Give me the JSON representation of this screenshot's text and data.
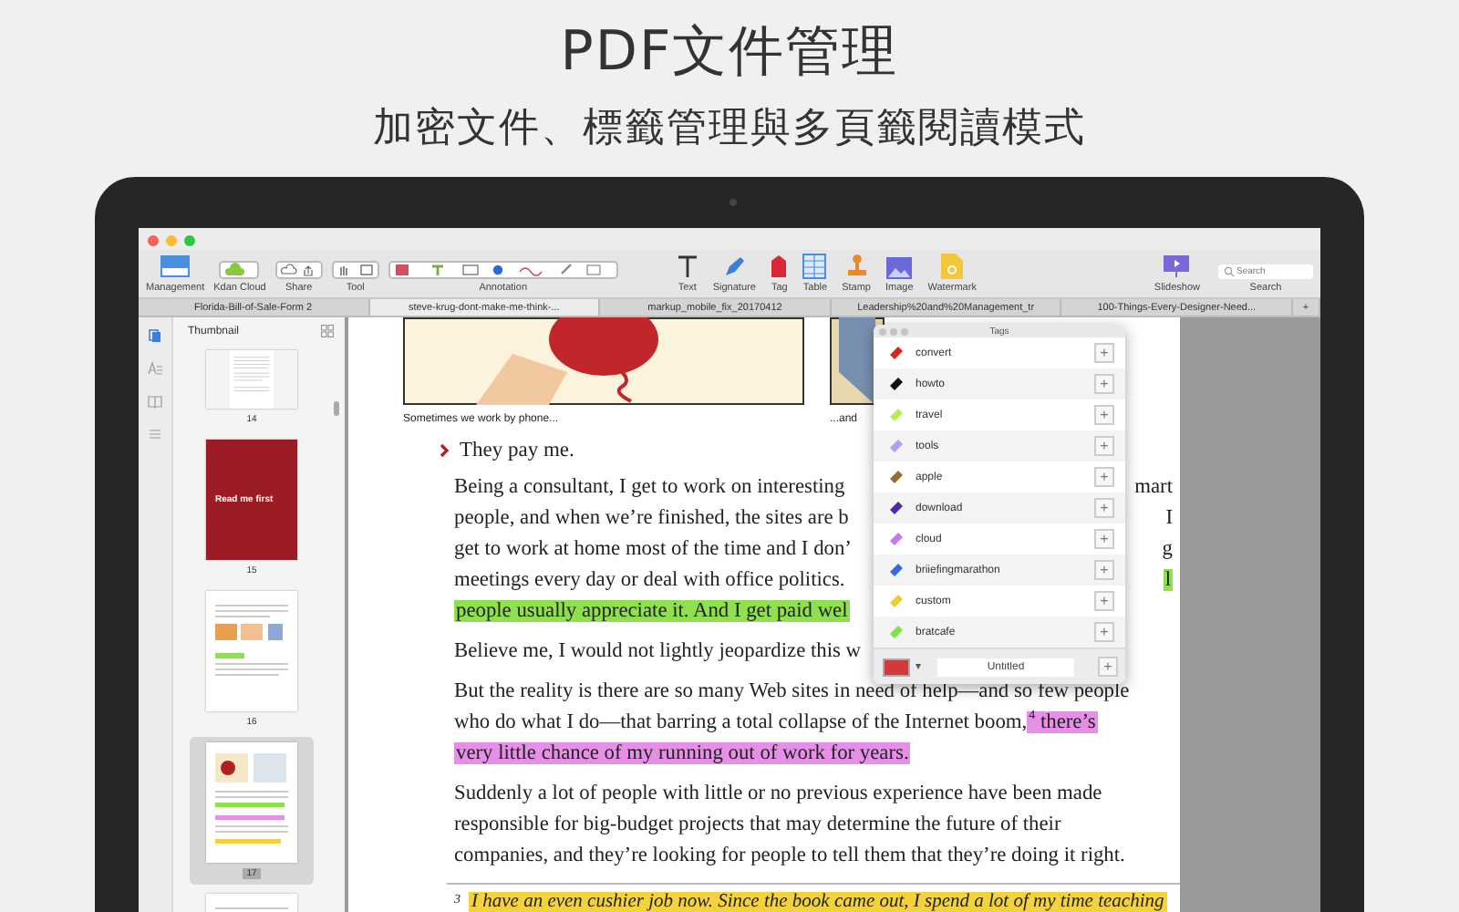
{
  "heading": {
    "title": "PDF文件管理",
    "subtitle": "加密文件、標籤管理與多頁籤閱讀模式"
  },
  "toolbar": [
    {
      "kind": "management",
      "label": "Management"
    },
    {
      "kind": "cloud",
      "label": "Kdan Cloud"
    },
    {
      "kind": "share",
      "label": "Share"
    },
    {
      "kind": "tool",
      "label": "Tool"
    },
    {
      "kind": "annotation",
      "label": "Annotation"
    },
    {
      "kind": "text",
      "label": "Text"
    },
    {
      "kind": "signature",
      "label": "Signature"
    },
    {
      "kind": "tag",
      "label": "Tag"
    },
    {
      "kind": "table",
      "label": "Table"
    },
    {
      "kind": "stamp",
      "label": "Stamp"
    },
    {
      "kind": "image",
      "label": "Image"
    },
    {
      "kind": "watermark",
      "label": "Watermark"
    },
    {
      "kind": "slideshow",
      "label": "Slideshow"
    },
    {
      "kind": "search",
      "label": "Search",
      "placeholder": "Search"
    }
  ],
  "tabs": [
    {
      "label": "Florida-Bill-of-Sale-Form 2",
      "selected": false
    },
    {
      "label": "steve-krug-dont-make-me-think-...",
      "selected": true
    },
    {
      "label": "markup_mobile_fix_20170412",
      "selected": false
    },
    {
      "label": "Leadership%20and%20Management_tr",
      "selected": false
    },
    {
      "label": "100-Things-Every-Designer-Need...",
      "selected": false
    },
    {
      "label": "+",
      "selected": false
    }
  ],
  "sidebar": {
    "icons": [
      {
        "kind": "pages",
        "selected": true
      },
      {
        "kind": "text",
        "selected": false
      },
      {
        "kind": "book",
        "selected": false
      },
      {
        "kind": "list",
        "selected": false
      }
    ]
  },
  "thumbnails": {
    "title": "Thumbnail",
    "pages": [
      {
        "kind": "text",
        "label": "14",
        "selected": false
      },
      {
        "kind": "cover",
        "label": "15",
        "cover_title": "Read me first",
        "selected": false
      },
      {
        "kind": "figures",
        "label": "16",
        "selected": false
      },
      {
        "kind": "comic",
        "label": "17",
        "selected": true
      },
      {
        "kind": "text",
        "selected": false
      }
    ]
  },
  "document": {
    "captions": [
      "Sometimes we work by phone...",
      "...and"
    ],
    "bullet": "They pay me.",
    "paragraphs": [
      {
        "lines": [
          {
            "left": [
              {
                "text": "Being a consultant, I get to work on interesting"
              }
            ],
            "right": [
              {
                "text": "mart"
              }
            ]
          },
          {
            "left": [
              {
                "text": "people, and when we’re finished, the sites are b"
              }
            ],
            "right": [
              {
                "text": "I"
              }
            ]
          },
          {
            "left": [
              {
                "text": "get to work at home most of the time and I don’"
              }
            ],
            "right": [
              {
                "text": "g"
              }
            ]
          },
          {
            "left": [
              {
                "text": "meetings every day or deal with office politics."
              }
            ],
            "right": [
              {
                "text": "l",
                "color": "#8fe04e"
              }
            ]
          },
          {
            "left": [
              {
                "text": "people usually appreciate it. And I get paid wel",
                "color": "#8fe04e"
              }
            ]
          }
        ]
      },
      {
        "lines": [
          {
            "left": [
              {
                "text": "Believe me, I would not lightly jeopardize this w"
              }
            ]
          }
        ]
      },
      {
        "lines": [
          {
            "left": [
              {
                "text": "But the reality is there are so many Web sites in need of help—and so few people"
              }
            ]
          },
          {
            "left": [
              {
                "text": "who do what I do—that barring a total collapse of the Internet boom,"
              },
              {
                "text": "$^{4}$ there’s",
                "color": "#e58fe6"
              }
            ]
          },
          {
            "left": [
              {
                "text": "very little chance of my running out of work for years.",
                "color": "#e58fe6"
              }
            ]
          }
        ]
      },
      {
        "lines": [
          {
            "left": [
              {
                "text": "Suddenly a lot of people with little or no previous experience have been made"
              }
            ]
          },
          {
            "left": [
              {
                "text": "responsible for big-budget projects that may determine the future of their"
              }
            ]
          },
          {
            "left": [
              {
                "text": "companies, and they’re looking for people to tell them that they’re doing it right."
              }
            ]
          }
        ]
      }
    ],
    "footnote": {
      "mark": "3",
      "text": "I have an even cushier job now. Since the book came out, I spend a lot of my time teaching",
      "color": "#f4d23c"
    }
  },
  "tags_panel": {
    "title": "Tags",
    "tags": [
      {
        "name": "convert",
        "color": "#d8261c",
        "button": "+"
      },
      {
        "name": "howto",
        "color": "#111111",
        "button": "+"
      },
      {
        "name": "travel",
        "color": "#b4ee5a",
        "button": "+"
      },
      {
        "name": "tools",
        "color": "#b49cf0",
        "button": "+"
      },
      {
        "name": "apple",
        "color": "#9a6a30",
        "button": "+"
      },
      {
        "name": "download",
        "color": "#4a2aa8",
        "button": "+"
      },
      {
        "name": "cloud",
        "color": "#c77ae8",
        "button": "+"
      },
      {
        "name": "briiefingmarathon",
        "color": "#3a6ae0",
        "button": "+"
      },
      {
        "name": "custom",
        "color": "#f0cc30",
        "button": "+"
      },
      {
        "name": "bratcafe",
        "color": "#7ee44a",
        "button": "+"
      }
    ],
    "new_tag": {
      "color": "#d23a3a",
      "value": "Untitled",
      "button": "+"
    }
  }
}
